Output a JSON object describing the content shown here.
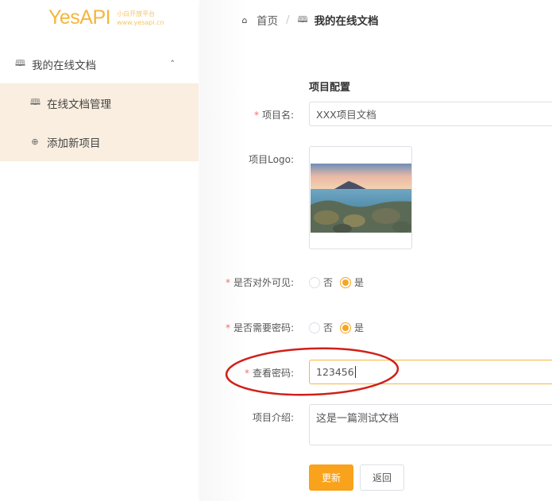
{
  "logo": {
    "text": "YesAPI",
    "tagline": "小白开放平台",
    "url": "www.yesapi.cn"
  },
  "sidebar": {
    "group": "我的在线文档",
    "items": [
      {
        "label": "在线文档管理",
        "icon": "book-icon"
      },
      {
        "label": "添加新项目",
        "icon": "plus-circle-icon"
      }
    ]
  },
  "breadcrumb": {
    "home": "首页",
    "current": "我的在线文档"
  },
  "form": {
    "title": "项目配置",
    "name_label": "项目名:",
    "name_value": "XXX项目文档",
    "logo_label": "项目Logo:",
    "visible_label": "是否对外可见:",
    "visible_options": [
      "否",
      "是"
    ],
    "visible_selected": "是",
    "need_pw_label": "是否需要密码:",
    "need_pw_options": [
      "否",
      "是"
    ],
    "need_pw_selected": "是",
    "pw_label": "查看密码:",
    "pw_value": "123456",
    "intro_label": "项目介绍:",
    "intro_value": "这是一篇测试文档",
    "submit": "更新",
    "back": "返回"
  },
  "colors": {
    "accent": "#f9a21b",
    "highlight": "#d0201a",
    "submenu_bg": "#f9eedf"
  }
}
